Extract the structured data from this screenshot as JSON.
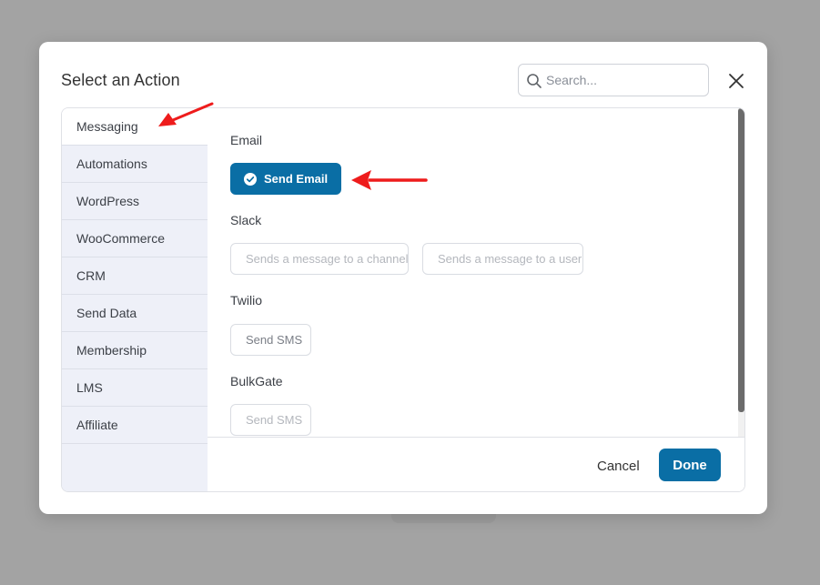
{
  "modal": {
    "title": "Select an Action",
    "search_placeholder": "Search..."
  },
  "sidebar": {
    "items": [
      {
        "label": "Messaging",
        "active": true
      },
      {
        "label": "Automations"
      },
      {
        "label": "WordPress"
      },
      {
        "label": "WooCommerce"
      },
      {
        "label": "CRM"
      },
      {
        "label": "Send Data"
      },
      {
        "label": "Membership"
      },
      {
        "label": "LMS"
      },
      {
        "label": "Affiliate"
      }
    ]
  },
  "groups": [
    {
      "label": "Email",
      "actions": [
        {
          "label": "Send Email",
          "selected": true
        }
      ]
    },
    {
      "label": "Slack",
      "actions": [
        {
          "label": "Sends a message to a channel"
        },
        {
          "label": "Sends a message to a user"
        }
      ]
    },
    {
      "label": "Twilio",
      "actions": [
        {
          "label": "Send SMS"
        }
      ]
    },
    {
      "label": "BulkGate",
      "actions": [
        {
          "label": "Send SMS"
        }
      ]
    }
  ],
  "footer": {
    "cancel_label": "Cancel",
    "done_label": "Done"
  },
  "colors": {
    "accent": "#0a6ea5",
    "annotation_arrow": "#ee1c1c",
    "backdrop": "#a3a3a3"
  }
}
